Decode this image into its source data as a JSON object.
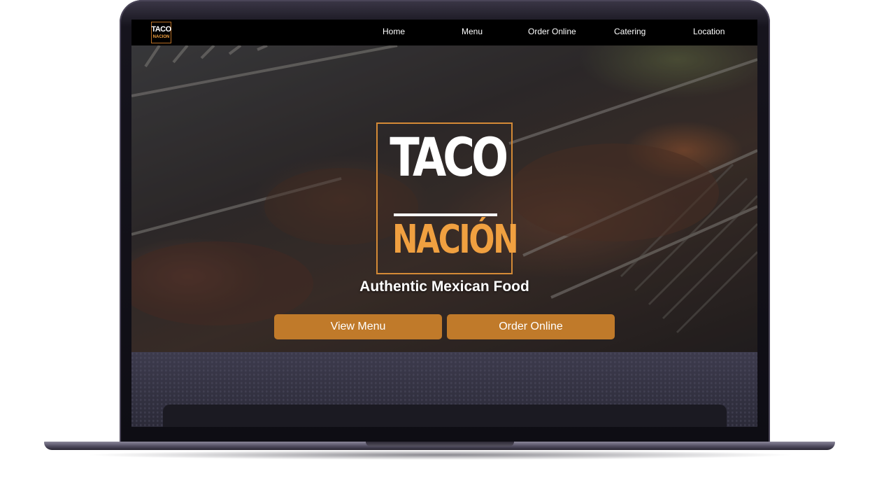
{
  "nav": {
    "logo": {
      "line1": "TACO",
      "line2": "NACION"
    },
    "items": [
      {
        "label": "Home"
      },
      {
        "label": "Menu"
      },
      {
        "label": "Order Online"
      },
      {
        "label": "Catering"
      },
      {
        "label": "Location"
      }
    ]
  },
  "hero": {
    "brand": {
      "line1": "TACO",
      "line2": "NACIÓN"
    },
    "tagline": "Authentic Mexican Food",
    "buttons": [
      {
        "label": "View Menu"
      },
      {
        "label": "Order Online"
      }
    ]
  },
  "colors": {
    "accent": "#c07a2a",
    "brand_orange": "#f0a040",
    "nav_bg": "#000000",
    "device_frame": "#16141d"
  }
}
